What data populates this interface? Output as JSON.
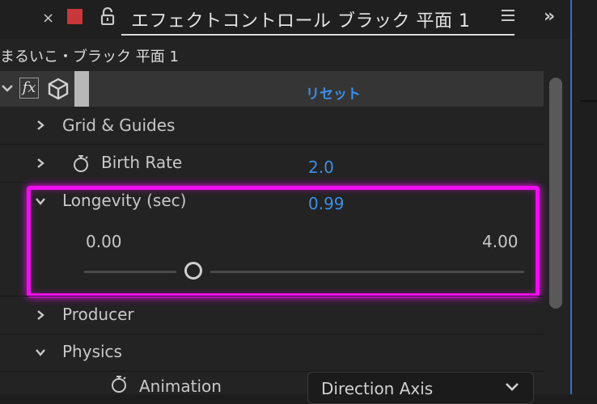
{
  "panel": {
    "tab_title": "エフェクトコントロール ブラック 平面 1",
    "close_glyph": "×",
    "chevrons_glyph": "»",
    "layer_title": "まるいこ・ブラック 平面 1",
    "swatch_color": "#c8373a",
    "accent_color": "#3d8ee6",
    "highlight_color": "#f00ef0"
  },
  "effect": {
    "reset_label": "リセット"
  },
  "properties": {
    "grid_guides": {
      "label": "Grid & Guides"
    },
    "birth_rate": {
      "label": "Birth Rate",
      "value": "2.0"
    },
    "longevity": {
      "label": "Longevity (sec)",
      "value": "0.99",
      "slider_min": "0.00",
      "slider_max": "4.00",
      "slider_fraction": 0.2475
    },
    "producer": {
      "label": "Producer"
    },
    "physics": {
      "label": "Physics"
    },
    "animation": {
      "label": "Animation",
      "selected": "Direction Axis"
    }
  }
}
